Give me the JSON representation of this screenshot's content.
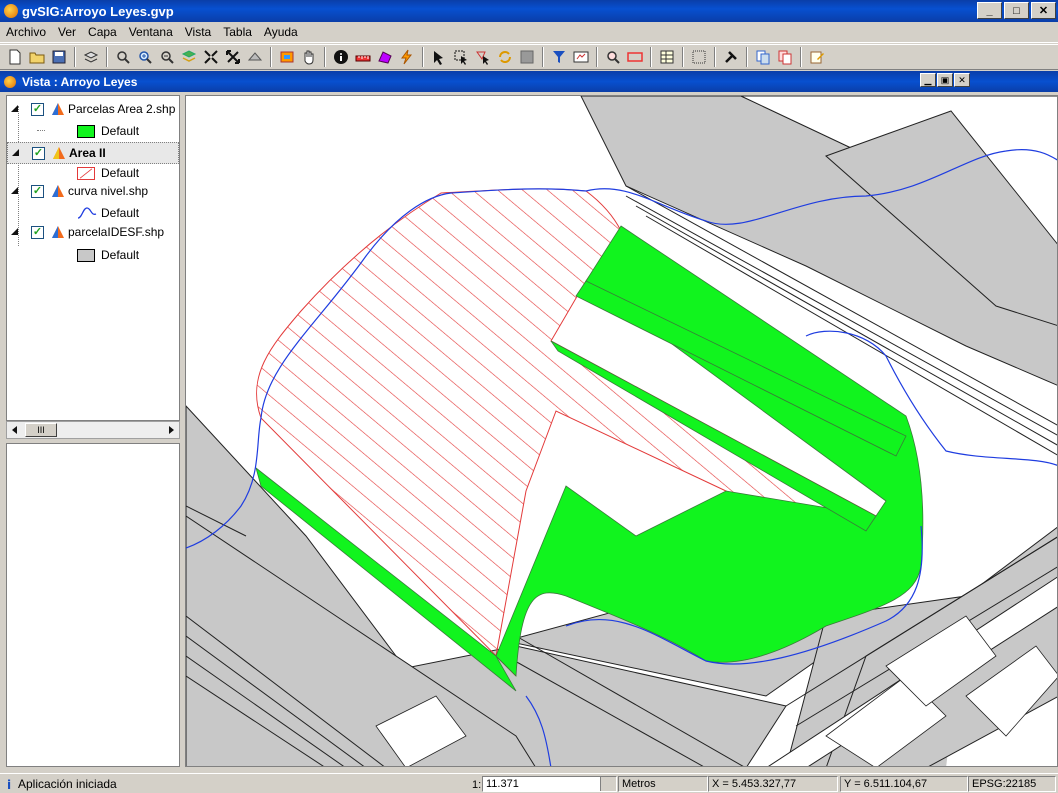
{
  "window": {
    "title": "gvSIG:Arroyo Leyes.gvp"
  },
  "menu": [
    "Archivo",
    "Ver",
    "Capa",
    "Ventana",
    "Vista",
    "Tabla",
    "Ayuda"
  ],
  "view": {
    "title": "Vista : Arroyo Leyes"
  },
  "toc": {
    "layers": [
      {
        "name": "Parcelas Area 2.shp",
        "legend_label": "Default",
        "checked": true,
        "bold": false
      },
      {
        "name": "Area II",
        "legend_label": "Default",
        "checked": true,
        "bold": true
      },
      {
        "name": "curva nivel.shp",
        "legend_label": "Default",
        "checked": true,
        "bold": false
      },
      {
        "name": "parcelaIDESF.shp",
        "legend_label": "Default",
        "checked": true,
        "bold": false
      }
    ],
    "scroll_thumb": "III"
  },
  "status": {
    "message": "Aplicación iniciada",
    "scale_prefix": "1:",
    "scale": "11.371",
    "units": "Metros",
    "x": "X = 5.453.327,77",
    "y": "Y = 6.511.104,67",
    "epsg": "EPSG:22185"
  },
  "colors": {
    "title_bar": "#0a3ea8",
    "parcel_fill": "#11f41e",
    "area_hatch": "#e33a3a",
    "contour": "#1f3de0",
    "cadastre_fill": "#c8c8c8"
  }
}
